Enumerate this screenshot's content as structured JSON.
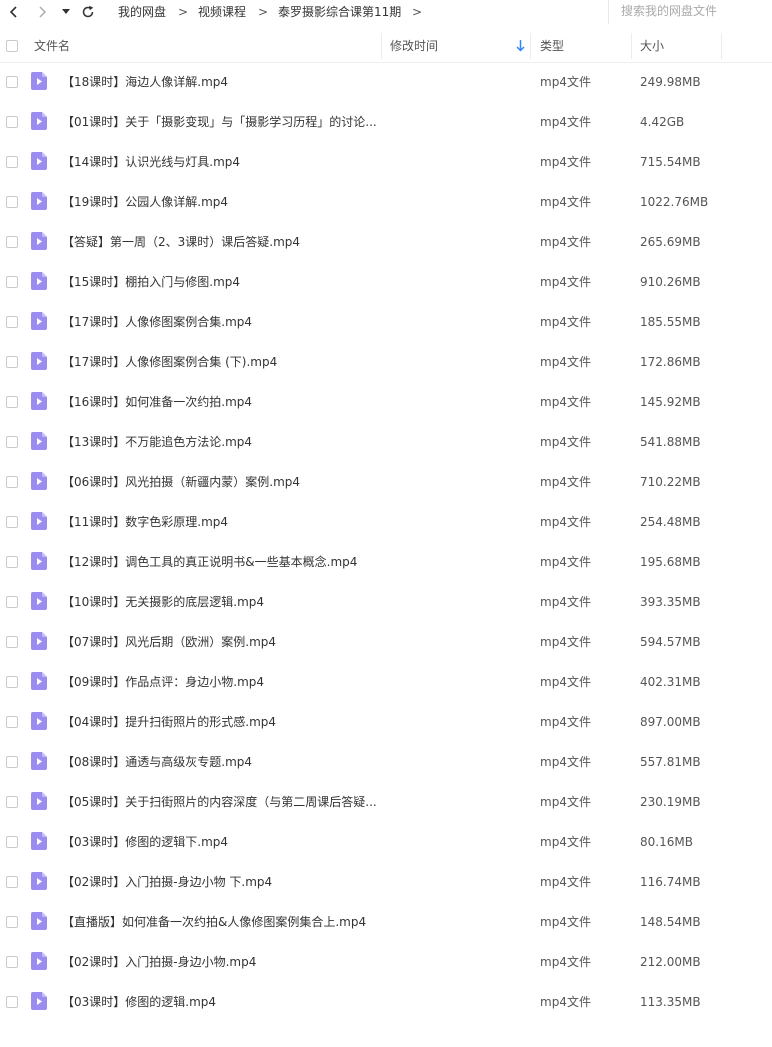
{
  "nav": {
    "breadcrumb": [
      "我的网盘",
      "视频课程",
      "泰罗摄影综合课第11期"
    ],
    "separator": ">",
    "search_placeholder": "搜索我的网盘文件"
  },
  "columns": {
    "name": "文件名",
    "modified": "修改时间",
    "type": "类型",
    "size": "大小"
  },
  "colors": {
    "file_icon": "#9b8cf0",
    "sort_arrow": "#2f86f6"
  },
  "files": [
    {
      "name": "【18课时】海边人像详解.mp4",
      "type": "mp4文件",
      "size": "249.98MB"
    },
    {
      "name": "【01课时】关于「摄影变现」与「摄影学习历程」的讨论...",
      "type": "mp4文件",
      "size": "4.42GB"
    },
    {
      "name": "【14课时】认识光线与灯具.mp4",
      "type": "mp4文件",
      "size": "715.54MB"
    },
    {
      "name": "【19课时】公园人像详解.mp4",
      "type": "mp4文件",
      "size": "1022.76MB"
    },
    {
      "name": "【答疑】第一周（2、3课时）课后答疑.mp4",
      "type": "mp4文件",
      "size": "265.69MB"
    },
    {
      "name": "【15课时】棚拍入门与修图.mp4",
      "type": "mp4文件",
      "size": "910.26MB"
    },
    {
      "name": "【17课时】人像修图案例合集.mp4",
      "type": "mp4文件",
      "size": "185.55MB"
    },
    {
      "name": "【17课时】人像修图案例合集 (下).mp4",
      "type": "mp4文件",
      "size": "172.86MB"
    },
    {
      "name": "【16课时】如何准备一次约拍.mp4",
      "type": "mp4文件",
      "size": "145.92MB"
    },
    {
      "name": "【13课时】不万能追色方法论.mp4",
      "type": "mp4文件",
      "size": "541.88MB"
    },
    {
      "name": "【06课时】风光拍摄（新疆内蒙）案例.mp4",
      "type": "mp4文件",
      "size": "710.22MB"
    },
    {
      "name": "【11课时】数字色彩原理.mp4",
      "type": "mp4文件",
      "size": "254.48MB"
    },
    {
      "name": "【12课时】调色工具的真正说明书&一些基本概念.mp4",
      "type": "mp4文件",
      "size": "195.68MB"
    },
    {
      "name": "【10课时】无关摄影的底层逻辑.mp4",
      "type": "mp4文件",
      "size": "393.35MB"
    },
    {
      "name": "【07课时】风光后期（欧洲）案例.mp4",
      "type": "mp4文件",
      "size": "594.57MB"
    },
    {
      "name": "【09课时】作品点评：身边小物.mp4",
      "type": "mp4文件",
      "size": "402.31MB"
    },
    {
      "name": "【04课时】提升扫街照片的形式感.mp4",
      "type": "mp4文件",
      "size": "897.00MB"
    },
    {
      "name": "【08课时】通透与高级灰专题.mp4",
      "type": "mp4文件",
      "size": "557.81MB"
    },
    {
      "name": "【05课时】关于扫街照片的内容深度（与第二周课后答疑...",
      "type": "mp4文件",
      "size": "230.19MB"
    },
    {
      "name": "【03课时】修图的逻辑下.mp4",
      "type": "mp4文件",
      "size": "80.16MB"
    },
    {
      "name": "【02课时】入门拍摄-身边小物 下.mp4",
      "type": "mp4文件",
      "size": "116.74MB"
    },
    {
      "name": "【直播版】如何准备一次约拍&人像修图案例集合上.mp4",
      "type": "mp4文件",
      "size": "148.54MB"
    },
    {
      "name": "【02课时】入门拍摄-身边小物.mp4",
      "type": "mp4文件",
      "size": "212.00MB"
    },
    {
      "name": "【03课时】修图的逻辑.mp4",
      "type": "mp4文件",
      "size": "113.35MB"
    }
  ]
}
